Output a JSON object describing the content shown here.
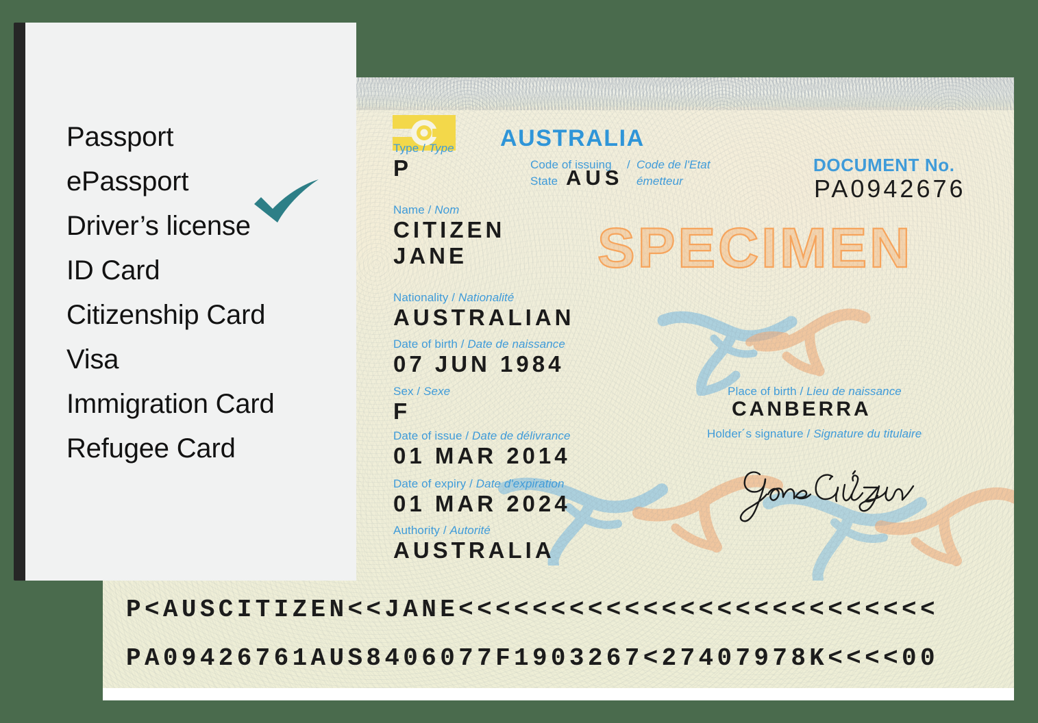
{
  "colors": {
    "background": "#4a6b4d",
    "panel_bg": "#f1f2f2",
    "panel_shadow": "#262626",
    "check_accent": "#2d7f87",
    "passport_paper": "#f0eed9",
    "label_blue": "#3f9bd9",
    "country_blue": "#2f95d8",
    "specimen_orange": "#f6a45c",
    "chip_yellow": "#f5d742",
    "value_ink": "#1b1b1b",
    "motif_blue": "#8dc6e8",
    "motif_orange": "#f3b98a"
  },
  "panel": {
    "title": "",
    "check_icon": "check-icon",
    "checked_item_index": 1,
    "items": [
      {
        "label": "Passport",
        "checked": false
      },
      {
        "label": "ePassport",
        "checked": true
      },
      {
        "label": "Driver’s license",
        "checked": false
      },
      {
        "label": "ID Card",
        "checked": false
      },
      {
        "label": "Citizenship Card",
        "checked": false
      },
      {
        "label": "Visa",
        "checked": false
      },
      {
        "label": "Immigration Card",
        "checked": false
      },
      {
        "label": "Refugee Card",
        "checked": false
      }
    ]
  },
  "passport": {
    "chip_icon": "biometric-chip-icon",
    "country": "AUSTRALIA",
    "watermark": "SPECIMEN",
    "document_number": {
      "label": "DOCUMENT No.",
      "value": "PA0942676"
    },
    "fields_left": [
      {
        "label_en": "Type",
        "label_fr": "Type",
        "value": "P"
      },
      {
        "label_en": "Name",
        "label_fr": "Nom",
        "value": "CITIZEN",
        "value2": "JANE"
      },
      {
        "label_en": "Nationality",
        "label_fr": "Nationalité",
        "value": "AUSTRALIAN"
      },
      {
        "label_en": "Date of birth",
        "label_fr": "Date de naissance",
        "value": "07 JUN 1984"
      },
      {
        "label_en": "Sex",
        "label_fr": "Sexe",
        "value": "F"
      },
      {
        "label_en": "Date of issue",
        "label_fr": "Date de délivrance",
        "value": "01 MAR 2014"
      },
      {
        "label_en": "Date of expiry",
        "label_fr": "Date d'expiration",
        "value": "01 MAR 2024"
      },
      {
        "label_en": "Authority",
        "label_fr": "Autorité",
        "value": "AUSTRALIA"
      }
    ],
    "issuing_state": {
      "label_line1_en": "Code of issuing",
      "label_line2_en": "State",
      "label_line1_fr": "Code de l'Etat",
      "label_line2_fr": "émetteur",
      "value": "AUS"
    },
    "fields_right": [
      {
        "label_en": "Place of birth",
        "label_fr": "Lieu de naissance",
        "value": "CANBERRA"
      },
      {
        "label_en": "Holder´s signature",
        "label_fr": "Signature du titulaire",
        "value": "Jane Citizen"
      }
    ],
    "signature_text": "Jane Citizen",
    "mrz": {
      "line1": "P<AUSCITIZEN<<JANE<<<<<<<<<<<<<<<<<<<<<<<<<<",
      "line2": "PA09426761AUS8406077F1903267<27407978K<<<<00"
    }
  }
}
